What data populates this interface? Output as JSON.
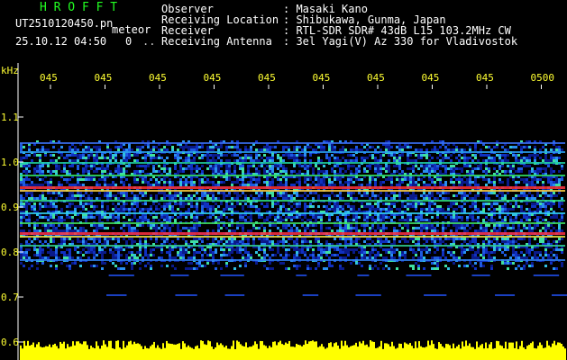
{
  "header": {
    "brand": "H R O F F T",
    "filename": "UT2510120450.pn",
    "mode": "meteor",
    "datetime": "25.10.12 04:50",
    "count": "0",
    "fields": [
      {
        "label": "Observer",
        "value": ": Masaki Kano"
      },
      {
        "label": "Receiving Location",
        "value": ": Shibukawa, Gunma, Japan"
      },
      {
        "label": "Receiver",
        "value": ": RTL-SDR SDR# 43dB L15 103.2MHz CW"
      },
      {
        "label": "Receiving Antenna",
        "value": ": 3el Yagi(V) Az 330 for Vladivostok"
      }
    ]
  },
  "spectrogram": {
    "freq_unit": "kHz",
    "freq_ticks": [
      "1.1",
      "1.0",
      "0.9",
      "0.8",
      "0.7",
      "0.6"
    ],
    "time_ticks": [
      "045",
      "045",
      "045",
      "045",
      "045",
      "045",
      "045",
      "045",
      "045",
      "0500"
    ],
    "colors": {
      "background": "#000000",
      "text": "#ffffff",
      "ticks": "#ffff33",
      "brand": "#22ff22",
      "signal_bar": "#ffff00"
    }
  }
}
